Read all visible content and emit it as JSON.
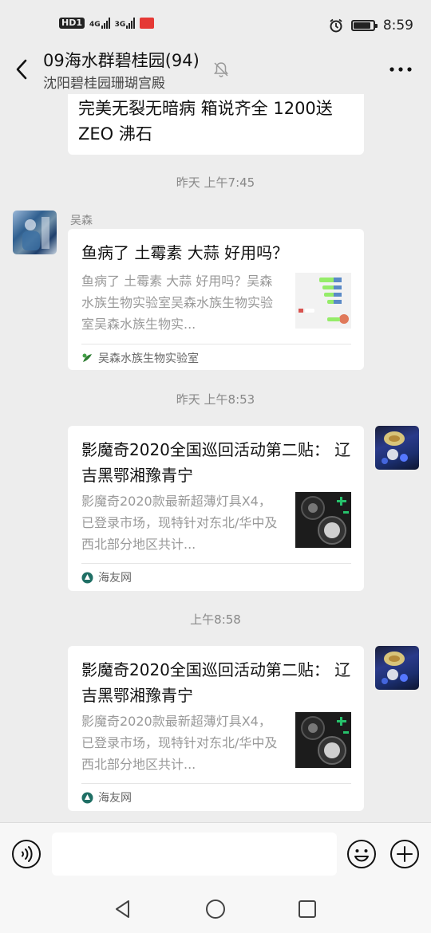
{
  "status_bar": {
    "hd_label": "HD",
    "hd_sub": "1",
    "net1": "4G",
    "net2": "3G",
    "time": "8:59",
    "battery_percent": 88
  },
  "header": {
    "title": "09海水群碧桂园(94)",
    "subtitle": "沈阳碧桂园珊瑚宫殿"
  },
  "messages": {
    "partial_text": "完美无裂无暗病 箱说齐全 1200送ZEO 沸石",
    "ts1": "昨天 上午7:45",
    "sender1": "吴森",
    "card1": {
      "title": "鱼病了 土霉素 大蒜 好用吗？",
      "desc": "鱼病了 土霉素 大蒜 好用吗？吴森水族生物实验室吴森水族生物实验室吴森水族生物实...",
      "source": "吴森水族生物实验室"
    },
    "ts2": "昨天 上午8:53",
    "card2": {
      "title": "影魔奇2020全国巡回活动第二贴： 辽吉黑鄂湘豫青宁",
      "desc": "影魔奇2020款最新超薄灯具X4，已登录市场，现特针对东北/华中及西北部分地区共计...",
      "source": "海友网"
    },
    "ts3": "上午8:58",
    "card3": {
      "title": "影魔奇2020全国巡回活动第二贴： 辽吉黑鄂湘豫青宁",
      "desc": "影魔奇2020款最新超薄灯具X4，已登录市场，现特针对东北/华中及西北部分地区共计...",
      "source": "海友网"
    }
  },
  "input": {
    "placeholder": ""
  },
  "icons": {
    "back": "back-arrow-icon",
    "mute": "mute-bell-icon",
    "more": "more-dots-icon",
    "voice": "voice-icon",
    "emoji": "emoji-icon",
    "plus": "plus-icon"
  },
  "colors": {
    "background": "#ededed",
    "bubble": "#ffffff",
    "accent_green": "#07c160",
    "status_red": "#e53935"
  }
}
